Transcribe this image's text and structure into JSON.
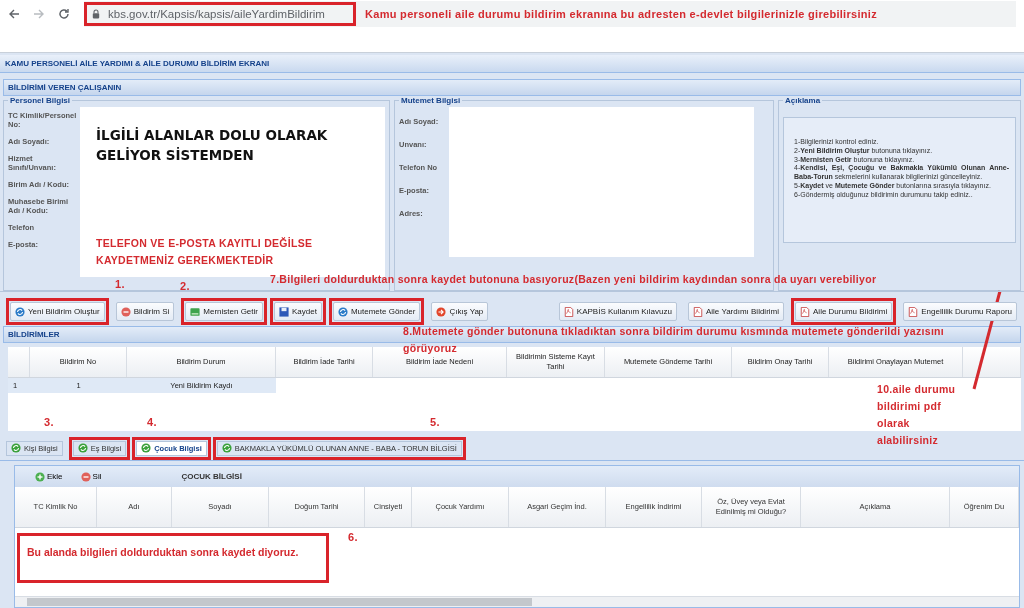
{
  "browser": {
    "url": "kbs.gov.tr/Kapsis/kapsis/aileYardimBildirim",
    "highlighted": true
  },
  "window": {
    "title": "KAMU PERSONELİ AİLE YARDIMI & AİLE DURUMU BİLDİRİM EKRANI"
  },
  "employee_section": {
    "title": "BİLDİRİMİ VEREN ÇALIŞANIN"
  },
  "personnel": {
    "legend": "Personel Bilgisi",
    "labels": [
      "TC Kimlik/Personel No:",
      "Adı Soyadı:",
      "Hizmet Sınıfı/Unvanı:",
      "Birim Adı / Kodu:",
      "Muhasebe Birimi Adı / Kodu:",
      "Telefon",
      "E-posta:"
    ]
  },
  "paymaster": {
    "legend": "Mutemet Bilgisi",
    "labels": [
      "Adı Soyad:",
      "Unvanı:",
      "Telefon No",
      "E-posta:",
      "Adres:"
    ]
  },
  "explanation": {
    "legend": "Açıklama",
    "steps": [
      "1-Bilgilerinizi kontrol ediniz.",
      "2-**Yeni Bildirim Oluştur** butonuna tıklayınız.",
      "3-**Mernisten Getir** butonuna tıklayınız.",
      "4-**Kendisi, Eşi, Çocuğu ve Bakmakla Yükümlü Olunan Anne-Baba-Torun** sekmelerini kullanarak bilgilerinizi güncelleyiniz.",
      "5-**Kaydet** ve **Mutemete Gönder** butonlarına sırasıyla tıklayınız.",
      "6-Göndermiş olduğunuz bildirimin durumunu takip ediniz.."
    ]
  },
  "toolbar": {
    "buttons": [
      {
        "label": "Yeni Bildirim Oluştur",
        "highlighted": true
      },
      {
        "label": "Bildirim Si",
        "highlighted": false
      },
      {
        "label": "Mernisten Getir",
        "highlighted": true
      },
      {
        "label": "Kaydet",
        "highlighted": true
      },
      {
        "label": "Mutemete Gönder",
        "highlighted": true
      },
      {
        "label": "Çıkış Yap",
        "highlighted": false
      }
    ],
    "report_buttons": [
      {
        "label": "KAPBİS Kullanım Kılavuzu",
        "highlighted": false
      },
      {
        "label": "Aile Yardımı Bildirimi",
        "highlighted": false
      },
      {
        "label": "Aile Durumu Bildirimi",
        "highlighted": true
      },
      {
        "label": "Engellilik Durumu Raporu",
        "highlighted": false
      }
    ]
  },
  "notifications": {
    "title": "BİLDİRİMLER",
    "columns": [
      "Bildirim No",
      "Bildirim Durum",
      "Bildirim İade Tarihi",
      "Bildirim İade Nedeni",
      "Bildirimin Sisteme Kayıt Tarihi",
      "Mutemete Göndeme Tarihi",
      "Bildirim Onay Tarihi",
      "Bildirimi Onaylayan Mutemet"
    ],
    "rows": [
      {
        "number": "1",
        "selected": true,
        "cells": [
          "1",
          "Yeni Bildirim Kaydı"
        ]
      }
    ]
  },
  "tabs": [
    {
      "label": "Kişi Bilgisi",
      "selected": false,
      "highlighted": false
    },
    {
      "label": "Eş Bilgisi",
      "selected": false,
      "highlighted": true
    },
    {
      "label": "Çocuk Bilgisi",
      "selected": true,
      "highlighted": true
    },
    {
      "label": "BAKMAKLA YÜKÜMLÜ OLUNAN ANNE - BABA - TORUN BİLGİSİ",
      "selected": false,
      "highlighted": true
    }
  ],
  "child_panel": {
    "buttons": [
      {
        "label": "Ekle"
      },
      {
        "label": "Sil"
      }
    ],
    "title": "ÇOCUK BİLGİSİ",
    "columns": [
      "TC Kimlik No",
      "Adı",
      "Soyadı",
      "Doğum Tarihi",
      "Cinsiyeti",
      "Çocuk Yardımı",
      "Asgari Geçim İnd.",
      "Engellilik İndirimi",
      "Öz, Üvey veya Evlat Edinilmiş mi Olduğu?",
      "Açıklama",
      "Öğrenim Du"
    ]
  },
  "annotations": [
    {
      "kind": "note",
      "text": "Kamu personeli aile durumu bildirim ekranına bu adresten e-devlet bilgilerinizle girebilirsiniz"
    },
    {
      "kind": "headline",
      "text": "İLGİLİ ALANLAR DOLU OLARAK GELİYOR SİSTEMDEN"
    },
    {
      "kind": "note",
      "text": "TELEFON VE E-POSTA KAYITLI DEĞİLSE KAYDETMENİZ GEREKMEKTEDİR"
    },
    {
      "kind": "note",
      "text": "1."
    },
    {
      "kind": "note",
      "text": "2."
    },
    {
      "kind": "note",
      "text": "7.Bilgileri doldurduktan sonra kaydet butonuna basıyoruz(Bazen yeni bildirim kaydından sonra da uyarı verebiliyor"
    },
    {
      "kind": "note",
      "text": "8.Mutemete gönder butonuna tıkladıktan sonra bildirim durumu kısmında mutemete gönderildi yazısını"
    },
    {
      "kind": "note",
      "text": "görüyoruz"
    },
    {
      "kind": "note",
      "text": "10.aile durumu bildirimi pdf olarak alabilirsiniz"
    },
    {
      "kind": "pointer"
    },
    {
      "kind": "note",
      "text": "3."
    },
    {
      "kind": "note",
      "text": "4."
    },
    {
      "kind": "note",
      "text": "5."
    },
    {
      "kind": "note",
      "text": "6."
    },
    {
      "kind": "boxed",
      "text": "Bu alanda bilgileri doldurduktan sonra kaydet diyoruz."
    }
  ]
}
